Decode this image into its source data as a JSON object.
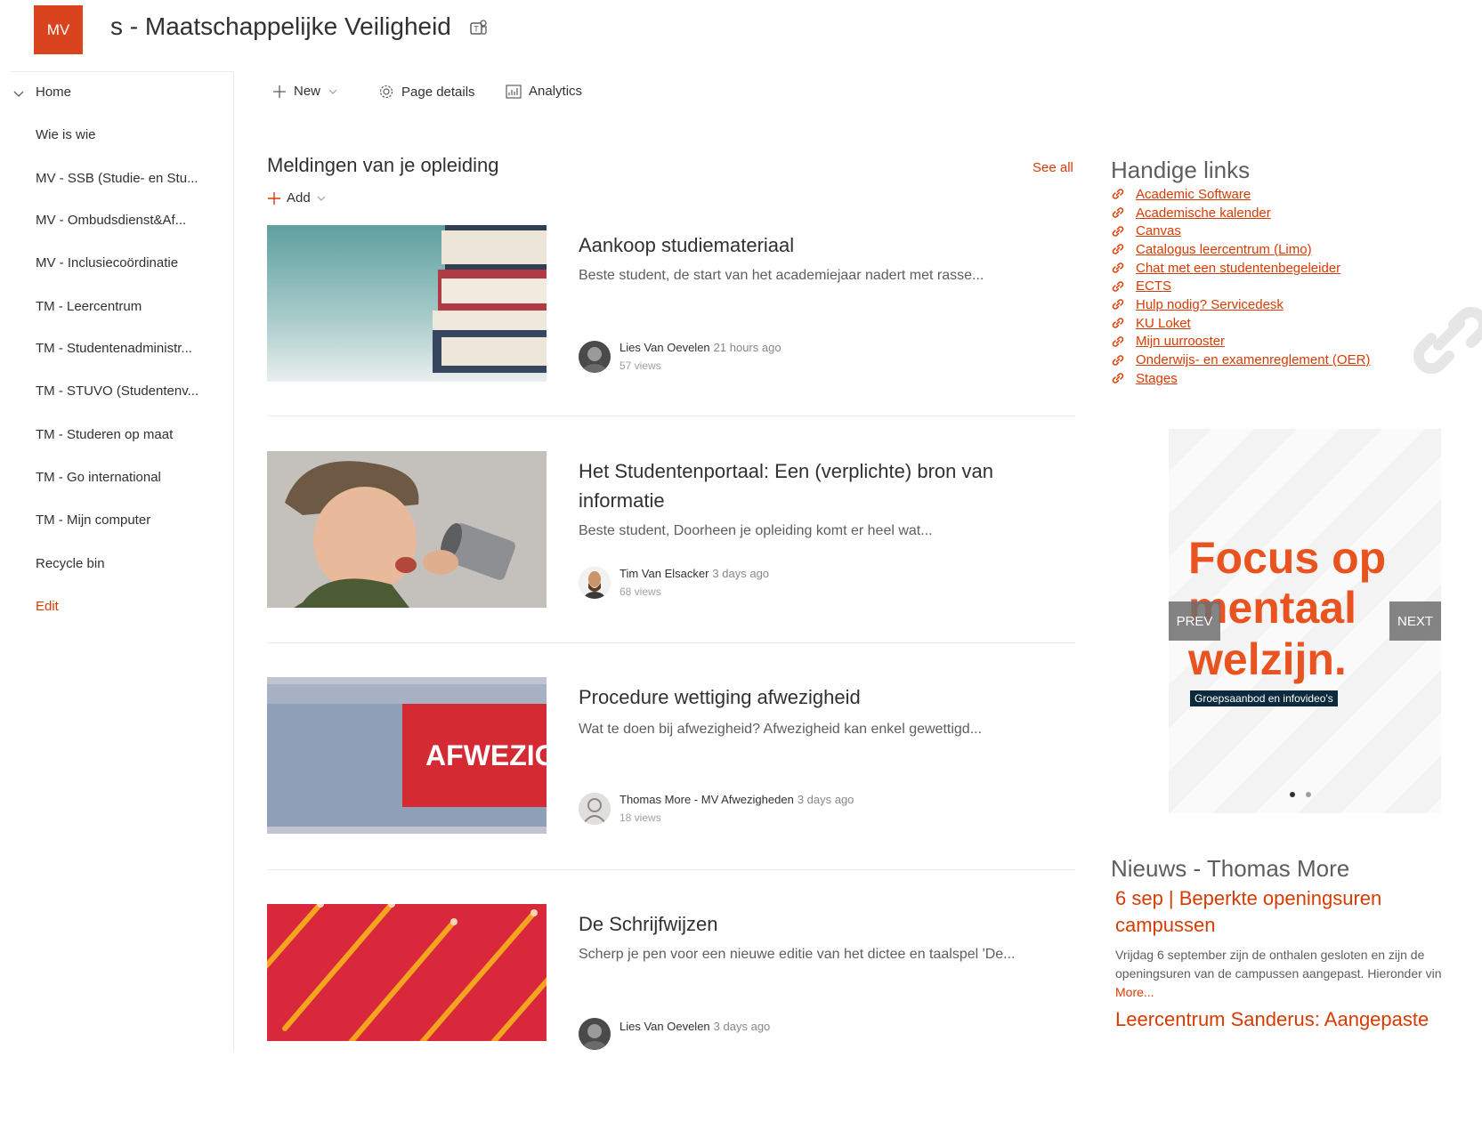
{
  "header": {
    "logo_initials": "MV",
    "site_title": "s - Maatschappelijke Veiligheid",
    "brand_color": "#d9441e"
  },
  "nav": {
    "items": [
      {
        "label": "Home"
      },
      {
        "label": "Wie is wie"
      },
      {
        "label": "MV - SSB (Studie- en Stu..."
      },
      {
        "label": "MV - Ombudsdienst&Af..."
      },
      {
        "label": "MV - Inclusiecoördinatie"
      },
      {
        "label": "TM - Leercentrum"
      },
      {
        "label": "TM - Studentenadministr..."
      },
      {
        "label": "TM - STUVO (Studentenv..."
      },
      {
        "label": "TM - Studeren op maat"
      },
      {
        "label": "TM - Go international"
      },
      {
        "label": "TM - Mijn computer"
      },
      {
        "label": "Recycle bin"
      }
    ],
    "edit_label": "Edit"
  },
  "commandbar": {
    "new_label": "New",
    "page_details_label": "Page details",
    "analytics_label": "Analytics"
  },
  "news": {
    "title": "Meldingen van je opleiding",
    "see_all": "See all",
    "add_label": "Add",
    "items": [
      {
        "title": "Aankoop studiemateriaal",
        "description": "Beste student, de start van het academiejaar nadert met rasse...",
        "author": "Lies Van Oevelen",
        "time": "21 hours ago",
        "views": "57 views"
      },
      {
        "title": "Het Studentenportaal: Een (verplichte) bron van informatie",
        "description": "Beste student, Doorheen je opleiding komt er heel wat...",
        "author": "Tim Van Elsacker",
        "time": "3 days ago",
        "views": "68 views"
      },
      {
        "title": "Procedure wettiging afwezigheid",
        "description": "Wat te doen bij afwezigheid? Afwezigheid kan enkel gewettigd...",
        "author": "Thomas More - MV Afwezigheden",
        "time": "3 days ago",
        "views": "18 views",
        "thumb_text": "AFWEZIG"
      },
      {
        "title": "De Schrijfwijzen",
        "description": "Scherp je pen voor een nieuwe editie van het dictee en taalspel 'De...",
        "author": "Lies Van Oevelen",
        "time": "3 days ago",
        "views": ""
      }
    ]
  },
  "quicklinks": {
    "title": "Handige links",
    "links": [
      "Academic Software",
      "Academische kalender",
      "Canvas",
      "Catalogus leercentrum (Limo)",
      "Chat met een studentenbegeleider",
      "ECTS",
      "Hulp nodig? Servicedesk",
      "KU Loket",
      "Mijn uurrooster",
      "Onderwijs- en examenreglement (OER)",
      "Stages"
    ]
  },
  "carousel": {
    "line1": "Focus op",
    "line2": "mentaal",
    "line3": "welzijn.",
    "tag": "Groepsaanbod en infovideo's",
    "prev": "PREV",
    "next": "NEXT",
    "accent": "#e8531f"
  },
  "external_news": {
    "title": "Nieuws - Thomas More",
    "items": [
      {
        "title": "6 sep | Beperkte openingsuren campussen",
        "description_line1": "Vrijdag 6 september zijn de onthalen gesloten en zijn de",
        "description_line2": "openingsuren van de campussen aangepast. Hieronder vin",
        "more": "More..."
      },
      {
        "title": "Leercentrum Sanderus: Aangepaste"
      }
    ]
  }
}
